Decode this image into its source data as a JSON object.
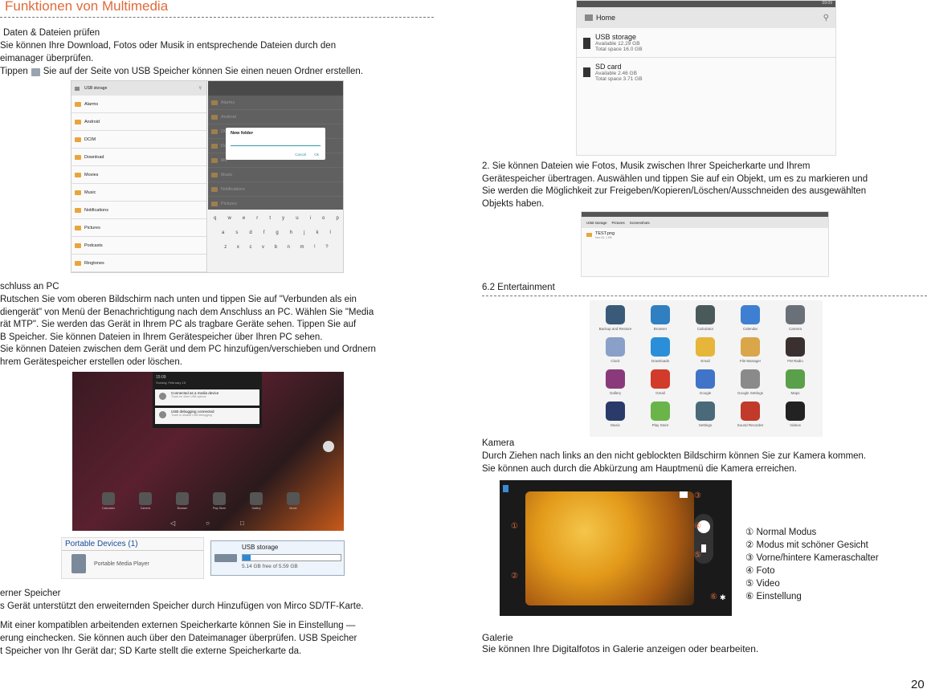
{
  "left": {
    "heading": "Funktionen von Multimedia",
    "section1": {
      "title": "Daten & Dateien prüfen",
      "line1": "Sie können Ihre Download, Fotos oder Musik in entsprechende Dateien durch den",
      "line2": "eimanager überprüfen.",
      "line3a": "Tippen",
      "line3b": "Sie auf der Seite von USB Speicher können Sie einen neuen Ordner erstellen."
    },
    "file_manager": {
      "breadcrumb": "USB storage",
      "folders": [
        "Alarms",
        "Android",
        "DCIM",
        "Download",
        "Movies",
        "Music",
        "Notifications",
        "Pictures",
        "Podcasts",
        "Ringtones"
      ],
      "dialog_title": "New folder",
      "dialog_cancel": "Cancel",
      "dialog_ok": "Ok",
      "right_folders": [
        "Alarms",
        "Android",
        "DCIM",
        "Do",
        "Mo",
        "Music",
        "Notifications",
        "Pictures"
      ],
      "keys_row1": [
        "q",
        "w",
        "e",
        "r",
        "t",
        "y",
        "u",
        "i",
        "o",
        "p"
      ],
      "keys_row2": [
        "a",
        "s",
        "d",
        "f",
        "g",
        "h",
        "j",
        "k",
        "l"
      ],
      "keys_row3": [
        "z",
        "x",
        "c",
        "v",
        "b",
        "n",
        "m",
        "!",
        "?"
      ]
    },
    "section2": {
      "title": "schluss an PC",
      "lines": [
        "Rutschen Sie vom oberen Bildschirm nach unten und tippen Sie auf \"Verbunden als ein",
        "diengerät\" von Menü der Benachrichtigung nach dem Anschluss an PC. Wählen Sie \"Media",
        "rät MTP\". Sie werden das Gerät in Ihrem PC als tragbare Geräte sehen. Tippen Sie auf",
        "B Speicher. Sie können Dateien in Ihrem Gerätespeicher über Ihren PC sehen.",
        "Sie können Dateien zwischen dem Gerät und dem PC hinzufügen/verschieben und Ordnern",
        "hrem Gerätespeicher erstellen oder löschen."
      ]
    },
    "notification": {
      "time": "15:09",
      "date": "Sunday, February 15",
      "n1_title": "Connected as a media device",
      "n1_sub": "Touch for other USB options",
      "n2_title": "USB debugging connected",
      "n2_sub": "Touch to disable USB debugging",
      "dock": [
        "Calculator",
        "Camera",
        "Browser",
        "Play Store",
        "Gallery",
        "Music"
      ]
    },
    "pc_window": {
      "portable_header": "Portable Devices (1)",
      "device": "Portable Media Player",
      "storage_name": "USB storage",
      "storage_free": "5.14 GB free of 5.59 GB",
      "storage_fill": 0.08
    },
    "section3": {
      "title": "erner Speicher",
      "line1": "s Gerät unterstützt den erweiternden Speicher durch Hinzufügen von Mirco SD/TF-Karte.",
      "line2": "Mit einer kompatiblen arbeitenden externen Speicherkarte können Sie in Einstellung —",
      "line3": "erung einchecken. Sie können auch über den Dateimanager überprüfen. USB Speicher",
      "line4": "t Speicher von Ihr Gerät dar; SD Karte stellt die externe Speicherkarte da."
    }
  },
  "right": {
    "storage_screen": {
      "status_time": "09:09",
      "home": "Home",
      "usb_title": "USB storage",
      "usb_avail": "Available 12.29 GB",
      "usb_total": "Total space 16.0 GB",
      "sd_title": "SD card",
      "sd_avail": "Available 2.46 GB",
      "sd_total": "Total space 3.71 GB"
    },
    "para2": [
      "2. Sie können Dateien wie Fotos, Musik zwischen Ihrer Speicherkarte und Ihrem",
      "Gerätespeicher übertragen. Auswählen und tippen Sie auf ein Objekt, um es zu markieren und",
      "Sie werden die Möglichkeit zur Freigeben/Kopieren/Löschen/Ausschneiden des ausgewählten",
      "Objekts haben."
    ],
    "screenshot_files": {
      "crumbs": [
        "USB storage",
        "Pictures",
        "Screenshots"
      ],
      "file": "TEST.png",
      "file_meta": "Nov 03, 1 KB"
    },
    "entertainment_heading": "6.2 Entertainment",
    "apps": [
      {
        "name": "Backup and Restore",
        "color": "#3a5a7a"
      },
      {
        "name": "Browser",
        "color": "#2f7fc1"
      },
      {
        "name": "Calculator",
        "color": "#4a5a5a"
      },
      {
        "name": "Calendar",
        "color": "#3f7fd1"
      },
      {
        "name": "Camera",
        "color": "#6a7078"
      },
      {
        "name": "Clock",
        "color": "#8aa0c8"
      },
      {
        "name": "Downloads",
        "color": "#2a8fd8"
      },
      {
        "name": "Email",
        "color": "#e6b53a"
      },
      {
        "name": "File Manager",
        "color": "#d9a64a"
      },
      {
        "name": "FM Radio",
        "color": "#3a3030"
      },
      {
        "name": "Gallery",
        "color": "#8a3a7a"
      },
      {
        "name": "Gmail",
        "color": "#d23a2a"
      },
      {
        "name": "Google",
        "color": "#3f74c8"
      },
      {
        "name": "Google Settings",
        "color": "#8a8a8a"
      },
      {
        "name": "Maps",
        "color": "#5aa04a"
      },
      {
        "name": "Music",
        "color": "#2a3a6a"
      },
      {
        "name": "Play Store",
        "color": "#6ab44a"
      },
      {
        "name": "Settings",
        "color": "#4a6a7a"
      },
      {
        "name": "Sound Recorder",
        "color": "#c23a2a"
      },
      {
        "name": "Videos",
        "color": "#222222"
      }
    ],
    "camera": {
      "title": "Kamera",
      "line1": "Durch Ziehen nach links an den nicht geblockten Bildschirm können Sie zur Kamera kommen.",
      "line2": "Sie können auch durch die Abkürzung am Hauptmenü die Kamera erreichen.",
      "labels": [
        "① Normal Modus",
        "② Modus mit schöner Gesicht",
        "③ Vorne/hintere Kameraschalter",
        "④ Foto",
        "⑤ Video",
        "⑥ Einstellung"
      ],
      "markers": [
        "①",
        "②",
        "③",
        "④",
        "⑤",
        "⑥"
      ]
    },
    "galerie": {
      "title": "Galerie",
      "line": "Sie können Ihre Digitalfotos in Galerie anzeigen oder bearbeiten."
    }
  },
  "page_number": "20"
}
